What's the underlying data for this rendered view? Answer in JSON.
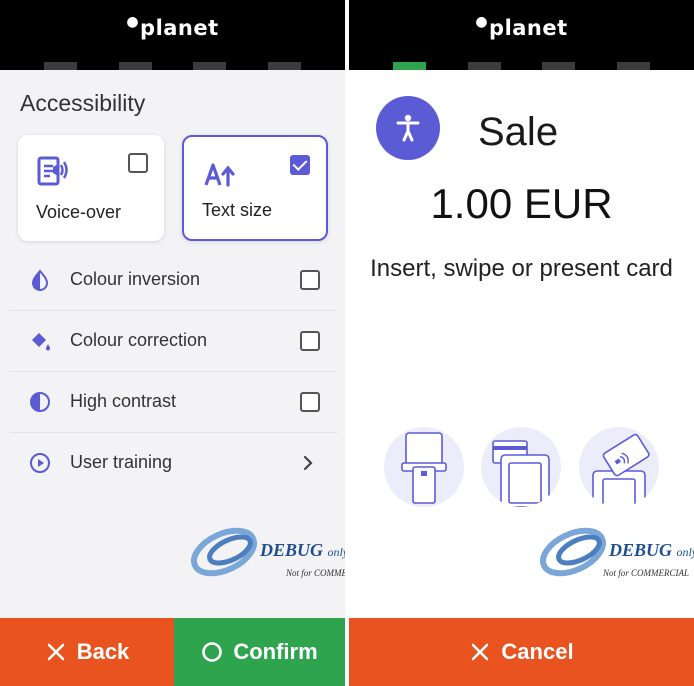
{
  "brand": "planet",
  "watermark": {
    "title": "DEBUG",
    "suffix": "only",
    "note": "Not for COMMERCIAL"
  },
  "left": {
    "title": "Accessibility",
    "cards": [
      {
        "label": "Voice-over",
        "checked": false,
        "icon": "voice-over-icon"
      },
      {
        "label": "Text size",
        "checked": true,
        "icon": "text-size-icon"
      }
    ],
    "options": [
      {
        "label": "Colour inversion",
        "icon": "colour-inversion-icon",
        "control": "checkbox",
        "checked": false
      },
      {
        "label": "Colour correction",
        "icon": "colour-correction-icon",
        "control": "checkbox",
        "checked": false
      },
      {
        "label": "High contrast",
        "icon": "high-contrast-icon",
        "control": "checkbox",
        "checked": false
      },
      {
        "label": "User training",
        "icon": "play-icon",
        "control": "chevron"
      }
    ],
    "back_label": "Back",
    "confirm_label": "Confirm",
    "active_step": 0
  },
  "right": {
    "transaction_type": "Sale",
    "amount": "1.00 EUR",
    "instruction": "Insert, swipe or present card",
    "cancel_label": "Cancel",
    "active_step": 1
  },
  "colors": {
    "accent": "#5b5bd6",
    "orange": "#e8531f",
    "green": "#2ea44f",
    "topbar": "#000000"
  }
}
